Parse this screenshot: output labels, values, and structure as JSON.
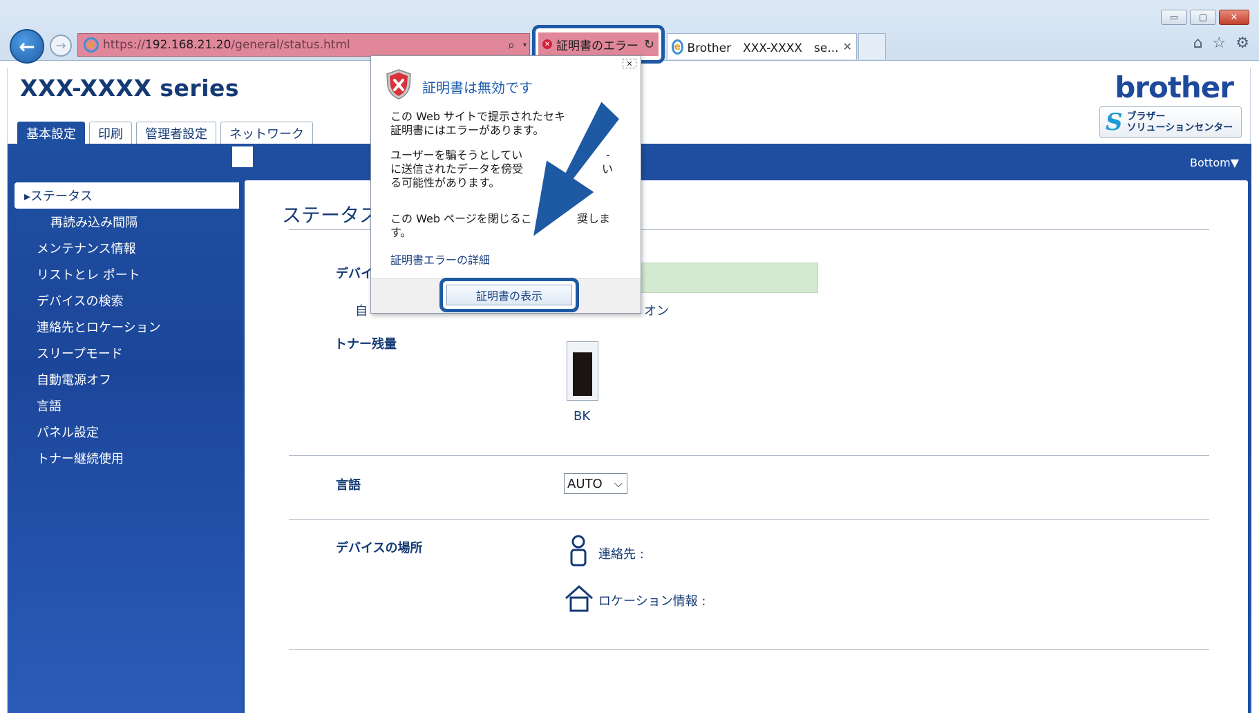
{
  "browser": {
    "url_prefix": "https://",
    "url_host": "192.168.21.20",
    "url_path": "/general/status.html",
    "cert_error_label": "証明書のエラー",
    "tab_label": "Brother　XXX-XXXX　se...",
    "window_controls": {
      "minimize": "▭",
      "maximize": "▢",
      "close": "✕"
    }
  },
  "header": {
    "model_title": "XXX-XXXX series",
    "brand": "brother",
    "solutions_label": "ブラザー\nソリューションセンター"
  },
  "tabs": [
    {
      "label": "基本設定",
      "active": true
    },
    {
      "label": "印刷"
    },
    {
      "label": "管理者設定"
    },
    {
      "label": "ネットワーク"
    }
  ],
  "bottom_link": "Bottom▼",
  "sidebar": {
    "items": [
      {
        "label": "▸ステータス",
        "active": true
      },
      {
        "label": "再読み込み間隔",
        "sub": true
      },
      {
        "label": "メンテナンス情報"
      },
      {
        "label": "リストとレ ポート"
      },
      {
        "label": "デバイスの検索"
      },
      {
        "label": "連絡先とロケーション"
      },
      {
        "label": "スリープモード"
      },
      {
        "label": "自動電源オフ"
      },
      {
        "label": "言語"
      },
      {
        "label": "パネル設定"
      },
      {
        "label": "トナー継続使用"
      }
    ]
  },
  "main": {
    "heading": "ステータス",
    "device_status_label": "デバイ",
    "auto_refresh_label": "自",
    "auto_refresh_value": "オン",
    "toner_label": "トナー残量",
    "toner_color": "BK",
    "toner_level": 0.9,
    "language_label": "言語",
    "language_value": "AUTO",
    "location_label": "デバイスの場所",
    "contact_label": "連絡先 :",
    "location_info_label": "ロケーション情報 :"
  },
  "popup": {
    "title": "証明書は無効です",
    "text1": "この Web サイトで提示されたセキ\n証明書にはエラーがあります。",
    "text2": "ユーザーを騙そうとしてい\nに送信されたデータを傍受\nる可能性があります。",
    "text2_tail1": "-",
    "text2_tail2": "い",
    "text3": "この Web ページを閉じるこ",
    "text3_tail": "奨しま",
    "text3_end": "す。",
    "details_link": "証明書エラーの詳細",
    "view_cert_button": "証明書の表示"
  },
  "colors": {
    "brand_blue": "#1f4fa0",
    "error_pink": "#e0879a",
    "highlight_outline": "#1d5aa3",
    "status_green": "#d4ead0"
  }
}
